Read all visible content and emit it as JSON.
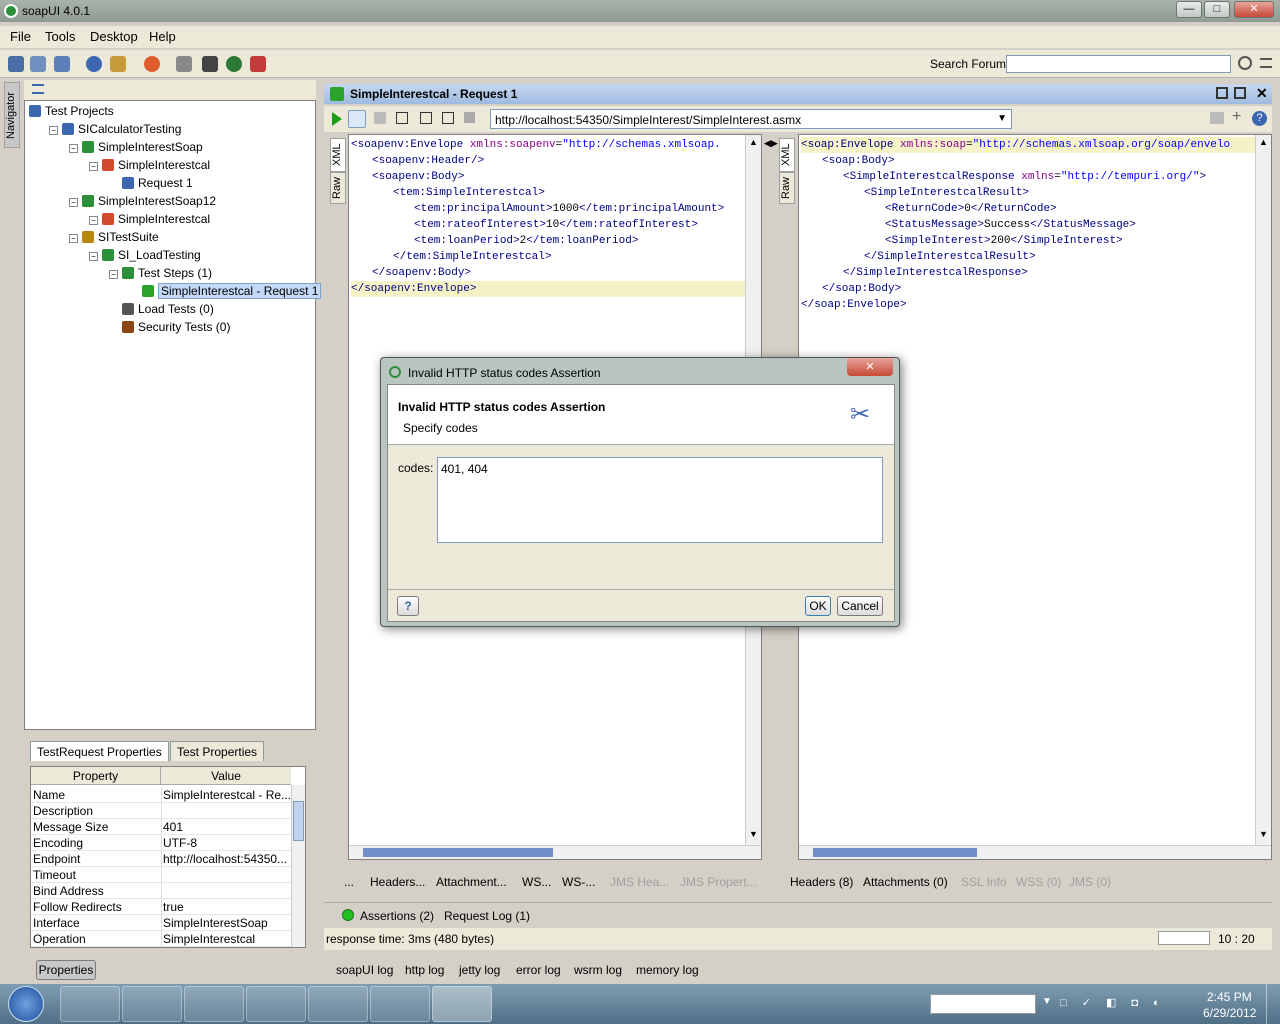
{
  "app": {
    "title": "soapUI 4.0.1"
  },
  "window_controls": {
    "minimize": "—",
    "maximize": "□",
    "close": "✕"
  },
  "menu": [
    "File",
    "Tools",
    "Desktop",
    "Help"
  ],
  "toolbar": {
    "search_label": "Search Forum",
    "search_value": ""
  },
  "navigator": {
    "label": "Navigator",
    "tree": [
      {
        "label": "Test Projects",
        "icon": "projects-icon",
        "level": 0
      },
      {
        "label": "SICalculatorTesting",
        "icon": "project-icon",
        "level": 1
      },
      {
        "label": "SimpleInterestSoap",
        "icon": "interface-icon",
        "level": 2
      },
      {
        "label": "SimpleInterestcal",
        "icon": "operation-icon",
        "level": 3
      },
      {
        "label": "Request 1",
        "icon": "request-icon",
        "level": 4
      },
      {
        "label": "SimpleInterestSoap12",
        "icon": "interface-icon",
        "level": 2
      },
      {
        "label": "SimpleInterestcal",
        "icon": "operation-icon",
        "level": 3
      },
      {
        "label": "SITestSuite",
        "icon": "testsuite-icon",
        "level": 2
      },
      {
        "label": "SI_LoadTesting",
        "icon": "testcase-icon",
        "level": 3
      },
      {
        "label": "Test Steps (1)",
        "icon": "teststeps-icon",
        "level": 4
      },
      {
        "label": "SimpleInterestcal - Request 1",
        "icon": "teststep-icon",
        "level": 5,
        "selected": true
      },
      {
        "label": "Load Tests (0)",
        "icon": "loadtests-icon",
        "level": 4
      },
      {
        "label": "Security Tests (0)",
        "icon": "securitytests-icon",
        "level": 4
      }
    ]
  },
  "props": {
    "tabs": [
      "TestRequest Properties",
      "Test Properties"
    ],
    "col_property": "Property",
    "col_value": "Value",
    "rows": [
      {
        "k": "Name",
        "v": "SimpleInterestcal - Re..."
      },
      {
        "k": "Description",
        "v": ""
      },
      {
        "k": "Message Size",
        "v": "401"
      },
      {
        "k": "Encoding",
        "v": "UTF-8"
      },
      {
        "k": "Endpoint",
        "v": "http://localhost:54350..."
      },
      {
        "k": "Timeout",
        "v": ""
      },
      {
        "k": "Bind Address",
        "v": ""
      },
      {
        "k": "Follow Redirects",
        "v": "true"
      },
      {
        "k": "Interface",
        "v": "SimpleInterestSoap"
      },
      {
        "k": "Operation",
        "v": "SimpleInterestcal"
      }
    ],
    "button": "Properties"
  },
  "editor": {
    "title": "SimpleInterestcal - Request 1",
    "endpoint": "http://localhost:54350/SimpleInterest/SimpleInterest.asmx",
    "request_vtabs": [
      "XML",
      "Raw"
    ],
    "response_vtabs": [
      "XML",
      "Raw"
    ],
    "request_lines": [
      {
        "indent": 0,
        "parts": [
          [
            "kw",
            "<soapenv:Envelope "
          ],
          [
            "at",
            "xmlns:soapenv"
          ],
          [
            "tx",
            "="
          ],
          [
            "st",
            "\"http://schemas.xmlsoap."
          ]
        ]
      },
      {
        "indent": 1,
        "parts": [
          [
            "kw",
            "<soapenv:Header/>"
          ]
        ]
      },
      {
        "indent": 1,
        "parts": [
          [
            "kw",
            "<soapenv:Body>"
          ]
        ]
      },
      {
        "indent": 2,
        "parts": [
          [
            "kw",
            "<tem:SimpleInterestcal>"
          ]
        ]
      },
      {
        "indent": 3,
        "parts": [
          [
            "kw",
            "<tem:principalAmount>"
          ],
          [
            "tx",
            "1000"
          ],
          [
            "kw",
            "</tem:principalAmount>"
          ]
        ]
      },
      {
        "indent": 3,
        "parts": [
          [
            "kw",
            "<tem:rateofInterest>"
          ],
          [
            "tx",
            "10"
          ],
          [
            "kw",
            "</tem:rateofInterest>"
          ]
        ]
      },
      {
        "indent": 3,
        "parts": [
          [
            "kw",
            "<tem:loanPeriod>"
          ],
          [
            "tx",
            "2"
          ],
          [
            "kw",
            "</tem:loanPeriod>"
          ]
        ]
      },
      {
        "indent": 2,
        "parts": [
          [
            "kw",
            "</tem:SimpleInterestcal>"
          ]
        ]
      },
      {
        "indent": 1,
        "parts": [
          [
            "kw",
            "</soapenv:Body>"
          ]
        ]
      },
      {
        "indent": 0,
        "parts": [
          [
            "kw",
            "</soapenv:Envelope>"
          ]
        ],
        "hl": true
      }
    ],
    "response_lines": [
      {
        "indent": 0,
        "parts": [
          [
            "kw",
            "<soap:Envelope "
          ],
          [
            "at",
            "xmlns:soap"
          ],
          [
            "tx",
            "="
          ],
          [
            "st",
            "\"http://schemas.xmlsoap.org/soap/envelo"
          ]
        ],
        "hl": true
      },
      {
        "indent": 1,
        "parts": [
          [
            "kw",
            "<soap:Body>"
          ]
        ]
      },
      {
        "indent": 2,
        "parts": [
          [
            "kw",
            "<SimpleInterestcalResponse "
          ],
          [
            "at",
            "xmlns"
          ],
          [
            "tx",
            "="
          ],
          [
            "st",
            "\"http://tempuri.org/\""
          ],
          [
            "kw",
            ">"
          ]
        ]
      },
      {
        "indent": 3,
        "parts": [
          [
            "kw",
            "<SimpleInterestcalResult>"
          ]
        ]
      },
      {
        "indent": 4,
        "parts": [
          [
            "kw",
            "<ReturnCode>"
          ],
          [
            "tx",
            "0"
          ],
          [
            "kw",
            "</ReturnCode>"
          ]
        ]
      },
      {
        "indent": 4,
        "parts": [
          [
            "kw",
            "<StatusMessage>"
          ],
          [
            "tx",
            "Success"
          ],
          [
            "kw",
            "</StatusMessage>"
          ]
        ]
      },
      {
        "indent": 4,
        "parts": [
          [
            "kw",
            "<SimpleInterest>"
          ],
          [
            "tx",
            "200"
          ],
          [
            "kw",
            "</SimpleInterest>"
          ]
        ]
      },
      {
        "indent": 3,
        "parts": [
          [
            "kw",
            "</SimpleInterestcalResult>"
          ]
        ]
      },
      {
        "indent": 2,
        "parts": [
          [
            "kw",
            "</SimpleInterestcalResponse>"
          ]
        ]
      },
      {
        "indent": 1,
        "parts": [
          [
            "kw",
            "</soap:Body>"
          ]
        ]
      },
      {
        "indent": 0,
        "parts": [
          [
            "kw",
            "</soap:Envelope>"
          ]
        ]
      }
    ],
    "request_tabs": [
      {
        "label": "...",
        "disabled": false
      },
      {
        "label": "Headers...",
        "disabled": false
      },
      {
        "label": "Attachment...",
        "disabled": false
      },
      {
        "label": "WS...",
        "disabled": false
      },
      {
        "label": "WS-...",
        "disabled": false
      },
      {
        "label": "JMS Hea...",
        "disabled": true
      },
      {
        "label": "JMS Propert...",
        "disabled": true
      }
    ],
    "response_tabs": [
      {
        "label": "Headers (8)",
        "disabled": false
      },
      {
        "label": "Attachments (0)",
        "disabled": false
      },
      {
        "label": "SSL Info",
        "disabled": true
      },
      {
        "label": "WSS (0)",
        "disabled": true
      },
      {
        "label": "JMS (0)",
        "disabled": true
      }
    ],
    "assertions_label": "Assertions (2)",
    "request_log_label": "Request Log (1)",
    "response_time": "response time: 3ms (480 bytes)",
    "cursor_pos": "10 : 20",
    "status_color": "#22c022"
  },
  "logs": [
    "soapUI log",
    "http log",
    "jetty log",
    "error log",
    "wsrm log",
    "memory log"
  ],
  "dialog": {
    "window_title": "Invalid HTTP status codes Assertion",
    "heading": "Invalid HTTP status codes Assertion",
    "subheading": "Specify codes",
    "codes_label": "codes:",
    "codes_value": "401, 404",
    "ok": "OK",
    "cancel": "Cancel",
    "help": "?",
    "close": "✕"
  },
  "taskbar": {
    "time": "2:45 PM",
    "date": "6/29/2012"
  }
}
